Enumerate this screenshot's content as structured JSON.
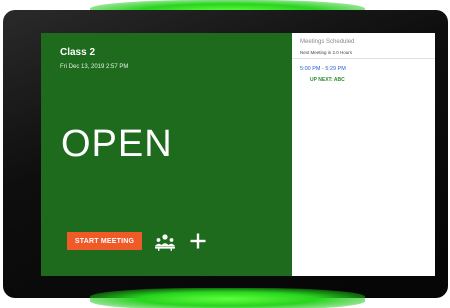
{
  "room": {
    "name": "Class 2",
    "datetime": "Fri Dec 13, 2019 2:57 PM",
    "status": "OPEN",
    "start_meeting_label": "START MEETING",
    "status_color": "#1e6b1e",
    "button_color": "#f05a28"
  },
  "icons": {
    "people": "people-icon",
    "add": "plus-icon"
  },
  "schedule": {
    "title": "Meetings Scheduled",
    "next_meeting": "Next Meeting in 2.0 Hours",
    "time_range": "5:00 PM - 5:29 PM",
    "up_next": "UP NEXT: ABC"
  },
  "device": {
    "led_color": "#39e52a"
  }
}
